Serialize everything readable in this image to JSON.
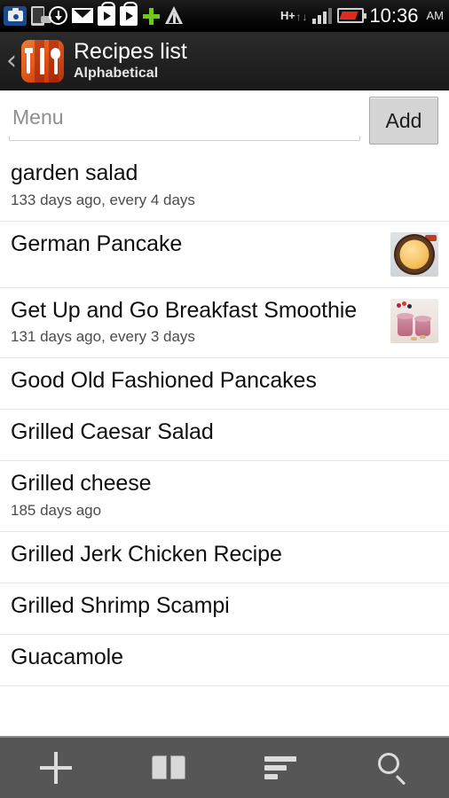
{
  "status_bar": {
    "time": "10:36",
    "ampm": "AM",
    "network_type": "H+",
    "icons": [
      "camera-icon",
      "usb-phone-icon",
      "download-sync-icon",
      "gmail-icon",
      "play-store-icon",
      "play-store-icon",
      "green-plus-icon",
      "warning-triangle-icon",
      "hspa-plus-data-icon",
      "signal-bars-icon",
      "battery-low-icon"
    ],
    "signal_bars_filled": 3,
    "signal_bars_total": 4,
    "battery_state": "low"
  },
  "header": {
    "back_label": "‹",
    "app_icon": "cutlery-icon",
    "title": "Recipes list",
    "subtitle": "Alphabetical"
  },
  "toolbar_top": {
    "input_placeholder": "Menu",
    "input_value": "",
    "add_label": "Add"
  },
  "recipes": [
    {
      "title": "garden salad",
      "subtitle": "133 days ago, every 4 days",
      "thumb": "none"
    },
    {
      "title": "German Pancake",
      "subtitle": "",
      "thumb": "pancake"
    },
    {
      "title": "Get Up and Go Breakfast Smoothie",
      "subtitle": "131 days ago, every 3 days",
      "thumb": "smoothie"
    },
    {
      "title": "Good Old Fashioned Pancakes",
      "subtitle": "",
      "thumb": "none"
    },
    {
      "title": "Grilled Caesar Salad",
      "subtitle": "",
      "thumb": "none"
    },
    {
      "title": "Grilled cheese",
      "subtitle": "185 days ago",
      "thumb": "none"
    },
    {
      "title": "Grilled Jerk Chicken Recipe",
      "subtitle": "",
      "thumb": "none"
    },
    {
      "title": "Grilled Shrimp Scampi",
      "subtitle": "",
      "thumb": "none"
    },
    {
      "title": "Guacamole",
      "subtitle": "",
      "thumb": "none"
    }
  ],
  "bottom_bar": {
    "buttons": [
      {
        "name": "add-recipe-button",
        "icon": "plus-icon"
      },
      {
        "name": "cookbook-button",
        "icon": "open-book-icon"
      },
      {
        "name": "sort-button",
        "icon": "sort-lines-icon"
      },
      {
        "name": "search-button",
        "icon": "magnifier-icon"
      }
    ]
  },
  "colors": {
    "accent_orange": "#e2561b",
    "status_bar_bg": "#0a0a0a",
    "header_bg": "#222222",
    "toolbar_bg": "#565656",
    "list_bg": "#ffffff",
    "separator": "#e6e6e6",
    "battery_red": "#e02a1a",
    "plus_green": "#72c422"
  }
}
